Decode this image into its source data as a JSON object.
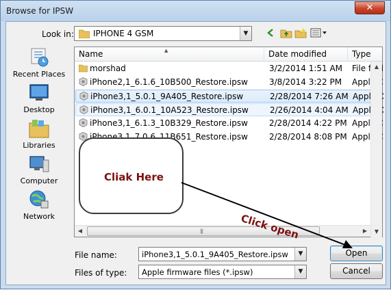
{
  "window": {
    "title": "Browse for IPSW",
    "close_glyph": "✕"
  },
  "toolbar": {
    "look_in_label": "Look in:",
    "look_in_value": "IPHONE 4 GSM"
  },
  "places": [
    {
      "label": "Recent Places",
      "icon": "recent-places-icon"
    },
    {
      "label": "Desktop",
      "icon": "desktop-icon"
    },
    {
      "label": "Libraries",
      "icon": "libraries-icon"
    },
    {
      "label": "Computer",
      "icon": "computer-icon"
    },
    {
      "label": "Network",
      "icon": "network-icon"
    }
  ],
  "columns": {
    "name": "Name",
    "date": "Date modified",
    "type": "Type"
  },
  "files": [
    {
      "name": "morshad",
      "date": "3/2/2014 1:51 AM",
      "type": "File folder",
      "icon": "folder-icon",
      "state": "normal"
    },
    {
      "name": "iPhone2,1_6.1.6_10B500_Restore.ipsw",
      "date": "3/8/2014 3:22 PM",
      "type": "Apple Device Software Update",
      "icon": "ipsw-file-icon",
      "state": "normal"
    },
    {
      "name": "iPhone3,1_5.0.1_9A405_Restore.ipsw",
      "date": "2/28/2014 7:26 AM",
      "type": "Apple Device Software Update",
      "icon": "ipsw-file-icon",
      "state": "selected"
    },
    {
      "name": "iPhone3,1_6.0.1_10A523_Restore.ipsw",
      "date": "2/26/2014 4:04 AM",
      "type": "Apple Device Software Update",
      "icon": "ipsw-file-icon",
      "state": "hover"
    },
    {
      "name": "iPhone3,1_6.1.3_10B329_Restore.ipsw",
      "date": "2/28/2014 4:22 PM",
      "type": "Apple Device Software Update",
      "icon": "ipsw-file-icon",
      "state": "normal"
    },
    {
      "name": "iPhone3,1_7.0.6_11B651_Restore.ipsw",
      "date": "2/28/2014 8:08 PM",
      "type": "Apple Device Software Update",
      "icon": "ipsw-file-icon",
      "state": "normal"
    }
  ],
  "bottom": {
    "file_name_label": "File name:",
    "file_name_value": "iPhone3,1_5.0.1_9A405_Restore.ipsw",
    "file_type_label": "Files of type:",
    "file_type_value": "Apple firmware files (*.ipsw)",
    "open_label": "Open",
    "cancel_label": "Cancel"
  },
  "annotations": {
    "callout": "Cliak Here",
    "arrow_label": "Click open",
    "color": "#7c1212"
  }
}
